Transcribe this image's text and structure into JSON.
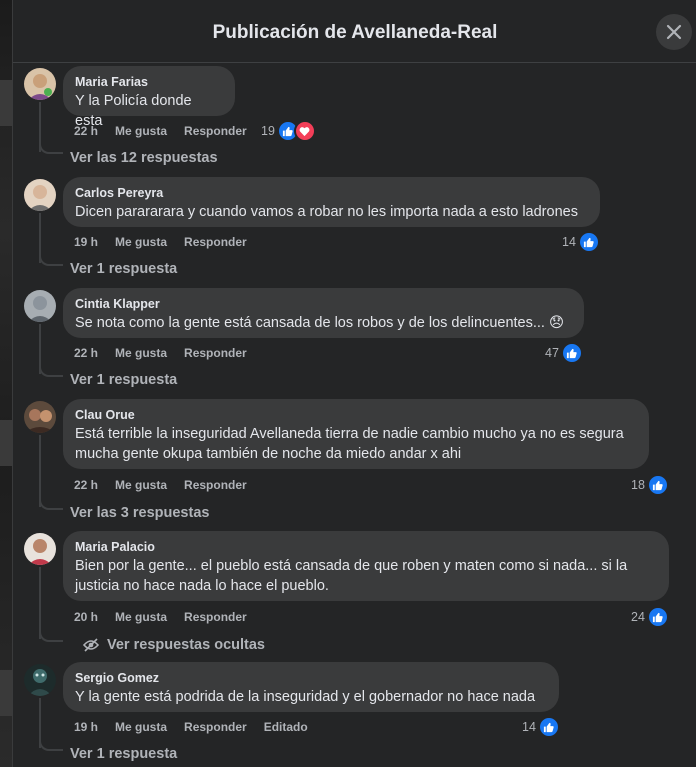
{
  "header": {
    "title": "Publicación de Avellaneda-Real"
  },
  "comments": [
    {
      "author": "Maria Farias",
      "text": "Y la Policía donde esta",
      "time": "22 h",
      "like": "Me gusta",
      "reply": "Responder",
      "edited": "",
      "count": "19",
      "replies": "Ver las 12 respuestas",
      "avatar_color": "#c9a07a"
    },
    {
      "author": "Carlos Pereyra",
      "text": "Dicen parararara y cuando vamos a robar no les importa nada a esto ladrones",
      "time": "19 h",
      "like": "Me gusta",
      "reply": "Responder",
      "edited": "",
      "count": "14",
      "replies": "Ver 1 respuesta",
      "avatar_color": "#d7b59a"
    },
    {
      "author": "Cintia Klapper",
      "text": "Se nota como la gente está cansada de los robos y de los delincuentes... 😞",
      "time": "22 h",
      "like": "Me gusta",
      "reply": "Responder",
      "edited": "",
      "count": "47",
      "replies": "Ver 1 respuesta",
      "avatar_color": "#8c949c"
    },
    {
      "author": "Clau Orue",
      "text": "Está terrible la inseguridad Avellaneda tierra de nadie cambio mucho ya no es segura mucha gente okupa también de noche da miedo andar x ahi",
      "time": "22 h",
      "like": "Me gusta",
      "reply": "Responder",
      "edited": "",
      "count": "18",
      "replies": "Ver las 3 respuestas",
      "avatar_color": "#a7765c"
    },
    {
      "author": "Maria Palacio",
      "text": "Bien por la gente... el pueblo está cansada de que roben y maten como si nada... si la justicia no hace nada lo hace el pueblo.",
      "time": "20 h",
      "like": "Me gusta",
      "reply": "Responder",
      "edited": "",
      "count": "24",
      "replies": "Ver respuestas ocultas",
      "avatar_color": "#c0394a"
    },
    {
      "author": "Sergio Gomez",
      "text": "Y la gente está podrida de la inseguridad y el gobernador no hace nada",
      "time": "19 h",
      "like": "Me gusta",
      "reply": "Responder",
      "edited": "Editado",
      "count": "14",
      "replies": "Ver 1 respuesta",
      "avatar_color": "#2f4a4a"
    }
  ],
  "icons": {
    "close": "close-icon",
    "like": "like-reaction-icon",
    "love": "love-reaction-icon",
    "hidden": "eye-slash-icon"
  },
  "colors": {
    "like": "#1877f2",
    "love": "#f33e58",
    "bubble": "#3a3b3c",
    "panel": "#242526"
  }
}
